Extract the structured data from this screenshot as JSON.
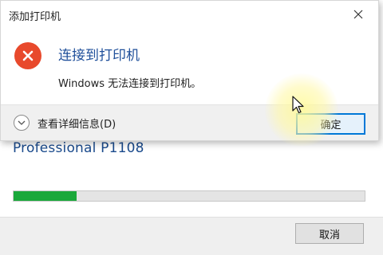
{
  "dialog": {
    "title": "添加打印机",
    "heading": "连接到打印机",
    "message": "Windows 无法连接到打印机。",
    "details_label": "查看详细信息(D)",
    "ok_label": "确定"
  },
  "background_window": {
    "printer_name": "Professional P1108",
    "cancel_label": "取消",
    "progress_fraction": 0.18
  },
  "icons": {
    "close": "close-icon",
    "error": "error-icon",
    "details": "chevron-down-icon",
    "cursor": "mouse-pointer-icon"
  },
  "colors": {
    "error_red": "#e8492c",
    "heading_blue": "#1f4f9a",
    "progress_green": "#1aa83a",
    "focus_blue": "#0078d7"
  }
}
